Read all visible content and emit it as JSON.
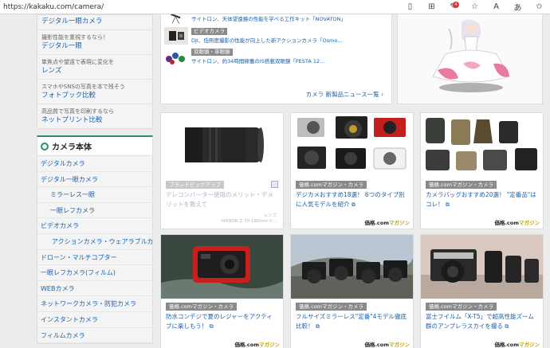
{
  "browser": {
    "url": "https://kakaku.com/camera/",
    "badge_count": "4",
    "icons": [
      "reader-icon",
      "grid-icon",
      "extension-icon",
      "favorite-icon",
      "read-aloud-icon",
      "translate-icon",
      "star-icon"
    ]
  },
  "sidebar": {
    "top_link": "デジタル一眼カメラ",
    "links": [
      {
        "small": "撮影性能を重視するなら！",
        "big": "デジタル一眼"
      },
      {
        "small": "単焦点や望遠で表現に変化を",
        "big": "レンズ"
      },
      {
        "small": "スマホやSNSの写真を本で残そう",
        "big": "フォトブック比較"
      },
      {
        "small": "高品質で写真を印刷するなら",
        "big": "ネットプリント比較"
      }
    ],
    "category_title": "カメラ本体",
    "categories": [
      {
        "label": "デジタルカメラ",
        "level": 1
      },
      {
        "label": "デジタル一眼カメラ",
        "level": 1
      },
      {
        "label": "ミラーレス一眼",
        "level": 2
      },
      {
        "label": "一眼レフカメラ",
        "level": 2
      },
      {
        "label": "ビデオカメラ",
        "level": 1
      },
      {
        "label": "アクションカメラ・ウェアラブルカメラ",
        "level": 2
      },
      {
        "label": "ドローン・マルチコプター",
        "level": 1
      },
      {
        "label": "一眼レフカメラ(フィルム)",
        "level": 1
      },
      {
        "label": "WEBカメラ",
        "level": 1
      },
      {
        "label": "ネットワークカメラ・防犯カメラ",
        "level": 1
      },
      {
        "label": "インスタントカメラ",
        "level": 1
      },
      {
        "label": "フィルムカメラ",
        "level": 1
      }
    ]
  },
  "news": {
    "items": [
      {
        "tag": "",
        "text": "サイトロン、天体望遠鏡の性能を学べる工作キット「NOVATON」"
      },
      {
        "tag": "ビデオカメラ",
        "text": "DJI、低照度撮影の性能が向上した新アクションカメラ「Osmo..."
      },
      {
        "tag": "双眼鏡・単眼鏡",
        "text": "サイトロン、約34時間稼働のIS搭載双眼鏡「FESTA 12..."
      }
    ],
    "more": "カメラ 新製品ニュース一覧"
  },
  "cards": [
    {
      "tag": "ブランドピックアップ",
      "title": "テレコンバーター使用のメリット・デメリットを教えて",
      "foot1": "レンズ",
      "foot2": "NIKKOR Z 70-180mm f/...",
      "brand": ""
    },
    {
      "tag": "価格.comマガジン・カメラ",
      "title": "デジカメおすすめ18選！ 6つのタイプ別に人気モデルを紹介",
      "brand_a": "価格.com",
      "brand_b": "マガジン"
    },
    {
      "tag": "価格.comマガジン・カメラ",
      "title": "カメラバッグおすすめ20選！ \"定番品\"はコレ！",
      "brand_a": "価格.com",
      "brand_b": "マガジン"
    },
    {
      "tag": "価格.comマガジン・カメラ",
      "title": "防水コンデジで夏のレジャーをアクティブに楽しもう！",
      "brand_a": "価格.com",
      "brand_b": "マガジン"
    },
    {
      "tag": "価格.comマガジン・カメラ",
      "title": "フルサイズミラーレス\"定番\"4モデル徹底比較！",
      "brand_a": "価格.com",
      "brand_b": "マガジン"
    },
    {
      "tag": "価格.comマガジン・カメラ",
      "title": "富士フイルム「X-T5」で超高性能ズーム群のアンプレラスカイを撮る",
      "brand_a": "価格.com",
      "brand_b": "マガジン"
    }
  ],
  "colors": {
    "link": "#1a5fa8",
    "accent": "#2f8a6e",
    "tag": "#8a8a8a",
    "brand_gold": "#c8a000"
  }
}
